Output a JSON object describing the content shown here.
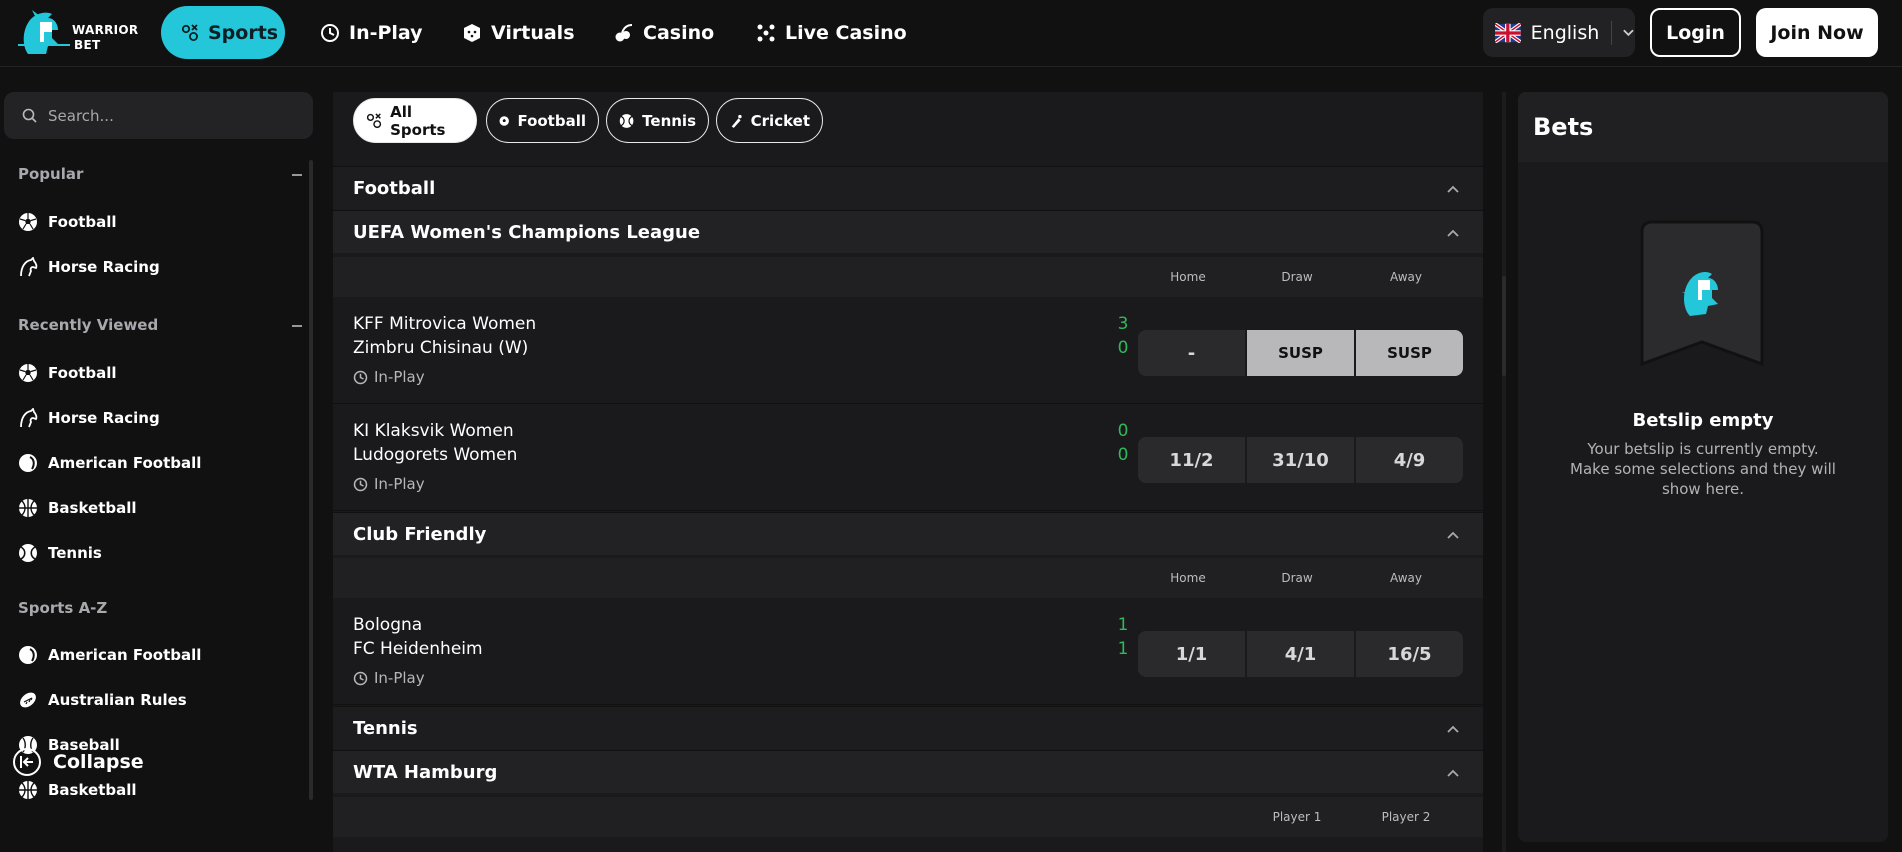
{
  "brand": {
    "line1": "WARRIOR",
    "line2": "BET",
    "accent": "#24c7da"
  },
  "nav": {
    "items": [
      {
        "label": "Sports",
        "icon": "sports-icon",
        "active": true
      },
      {
        "label": "In-Play",
        "icon": "inplay-icon"
      },
      {
        "label": "Virtuals",
        "icon": "dice-icon"
      },
      {
        "label": "Casino",
        "icon": "cherry-icon"
      },
      {
        "label": "Live Casino",
        "icon": "dice-dots-icon"
      }
    ],
    "language": "English",
    "login": "Login",
    "join": "Join Now"
  },
  "sidebar": {
    "search_placeholder": "Search...",
    "popular_title": "Popular",
    "popular": [
      {
        "label": "Football",
        "icon": "football-icon"
      },
      {
        "label": "Horse Racing",
        "icon": "horse-icon"
      }
    ],
    "recent_title": "Recently Viewed",
    "recent": [
      {
        "label": "Football",
        "icon": "football-icon"
      },
      {
        "label": "Horse Racing",
        "icon": "horse-icon"
      },
      {
        "label": "American Football",
        "icon": "american-football-icon"
      },
      {
        "label": "Basketball",
        "icon": "basketball-icon"
      },
      {
        "label": "Tennis",
        "icon": "tennis-icon"
      }
    ],
    "az_title": "Sports A-Z",
    "az": [
      {
        "label": "American Football",
        "icon": "american-football-icon"
      },
      {
        "label": "Australian Rules",
        "icon": "australian-rules-icon"
      },
      {
        "label": "Baseball",
        "icon": "baseball-icon"
      },
      {
        "label": "Basketball",
        "icon": "basketball-icon"
      }
    ],
    "collapse": "Collapse"
  },
  "filters": [
    {
      "label": "All Sports",
      "active": true
    },
    {
      "label": "Football"
    },
    {
      "label": "Tennis"
    },
    {
      "label": "Cricket"
    }
  ],
  "sections": {
    "football": "Football",
    "uefa": "UEFA Women's Champions League",
    "club": "Club Friendly",
    "tennis": "Tennis",
    "wta": "WTA Hamburg"
  },
  "columns": {
    "home": "Home",
    "draw": "Draw",
    "away": "Away",
    "player1": "Player 1",
    "player2": "Player 2"
  },
  "matches": [
    {
      "home": "KFF Mitrovica Women",
      "away": "Zimbru Chisinau (W)",
      "score_home": "3",
      "score_away": "0",
      "status": "In-Play",
      "odds": [
        "-",
        "SUSP",
        "SUSP"
      ]
    },
    {
      "home": "KI Klaksvik Women",
      "away": "Ludogorets Women",
      "score_home": "0",
      "score_away": "0",
      "status": "In-Play",
      "odds": [
        "11/2",
        "31/10",
        "4/9"
      ]
    },
    {
      "home": "Bologna",
      "away": "FC Heidenheim",
      "score_home": "1",
      "score_away": "1",
      "status": "In-Play",
      "odds": [
        "1/1",
        "4/1",
        "16/5"
      ]
    }
  ],
  "betslip": {
    "title": "Bets",
    "empty_title": "Betslip empty",
    "empty_msg": "Your betslip is currently empty. Make some selections and they will show here."
  }
}
